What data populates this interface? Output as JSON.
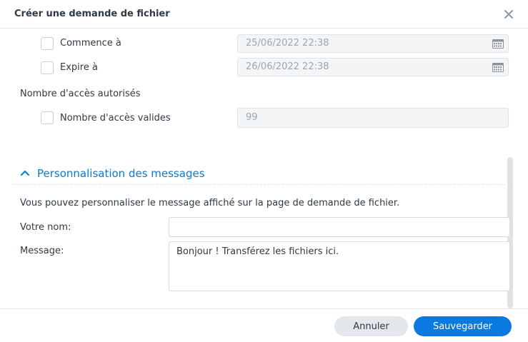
{
  "dialog": {
    "title": "Créer une demande de fichier",
    "close_icon": "close-icon"
  },
  "schedule": {
    "start": {
      "label": "Commence à",
      "checked": false,
      "value": "25/06/2022 22:38",
      "icon": "calendar-icon"
    },
    "expire": {
      "label": "Expire à",
      "checked": false,
      "value": "26/06/2022 22:38",
      "icon": "calendar-icon"
    }
  },
  "access": {
    "section_label": "Nombre d'accès autorisés",
    "valid_label": "Nombre d'accès valides",
    "checked": false,
    "value": "99"
  },
  "messages": {
    "section_title": "Personnalisation des messages",
    "expanded": true,
    "icon": "chevron-up-icon",
    "description": "Vous pouvez personnaliser le message affiché sur la page de demande de fichier.",
    "name_label": "Votre nom:",
    "name_value": "",
    "message_label": "Message:",
    "message_value": "Bonjour ! Transférez les fichiers ici."
  },
  "footer": {
    "cancel_label": "Annuler",
    "save_label": "Sauvegarder"
  },
  "colors": {
    "accent": "#0a79e0",
    "section_title": "#0a79d3"
  }
}
